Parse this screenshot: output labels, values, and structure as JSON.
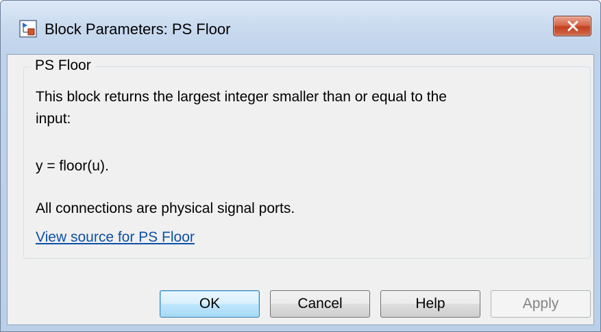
{
  "window": {
    "title": "Block Parameters: PS Floor"
  },
  "group": {
    "title": "PS Floor",
    "description_line1": "This block returns the largest integer smaller than or equal to the",
    "description_line2": "input:",
    "equation": "y = floor(u).",
    "connections": "All connections are physical signal ports.",
    "source_link": "View source for PS Floor"
  },
  "buttons": {
    "ok": "OK",
    "cancel": "Cancel",
    "help": "Help",
    "apply": "Apply"
  },
  "icons": {
    "title": "simulink-block-icon",
    "close": "close-icon"
  },
  "colors": {
    "link": "#0b4fa8",
    "close_button": "#c2401f",
    "default_button_border": "#3c7fb1",
    "disabled_text": "#838383"
  }
}
